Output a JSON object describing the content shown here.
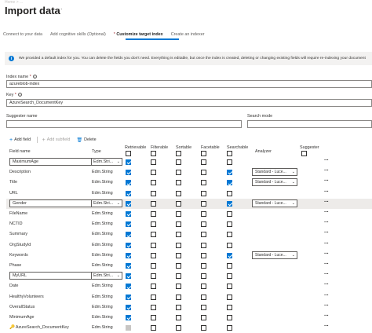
{
  "header": {
    "breadcrumb": "Home > ...",
    "title": "Import data",
    "more_label": "···"
  },
  "tabs": [
    {
      "label": "Connect to your data",
      "active": false
    },
    {
      "label": "Add cognitive skills (Optional)",
      "active": false
    },
    {
      "label": "Customize target index",
      "active": true
    },
    {
      "label": "Create an indexer",
      "active": false
    }
  ],
  "info": {
    "icon": "info-icon",
    "text": "We provided a default index for you. You can delete the fields you don't need. Everything is editable, but once the index is created, deleting or changing existing fields will require re-indexing your document"
  },
  "form": {
    "index_name_label": "Index name",
    "index_name_value": "azureblob-index",
    "key_label": "Key",
    "key_value": "AzureSearch_DocumentKey",
    "suggester_label": "Suggester name",
    "suggester_value": "",
    "search_mode_label": "Search mode",
    "search_mode_value": "",
    "required_mark": "*",
    "info_glyph": "i"
  },
  "toolbar": {
    "add_field": "Add field",
    "add_subfield": "Add subfield",
    "delete": "Delete"
  },
  "columns": {
    "field_name": "Field name",
    "type": "Type",
    "retrievable": "Retrievable",
    "filterable": "Filterable",
    "sortable": "Sortable",
    "facetable": "Facetable",
    "searchable": "Searchable",
    "analyzer": "Analyzer",
    "suggester": "Suggester"
  },
  "rows": [
    {
      "name": "MaximumAge",
      "type": "Edm.Stri...",
      "editable": true,
      "retrievable": true,
      "filterable": false,
      "sortable": false,
      "facetable": false,
      "searchable": false,
      "analyzer": ""
    },
    {
      "name": "Description",
      "type": "Edm.String",
      "editable": false,
      "retrievable": true,
      "filterable": false,
      "sortable": false,
      "facetable": false,
      "searchable": true,
      "analyzer": "Standard - Luce..."
    },
    {
      "name": "Title",
      "type": "Edm.String",
      "editable": false,
      "retrievable": true,
      "filterable": false,
      "sortable": false,
      "facetable": false,
      "searchable": true,
      "analyzer": "Standard - Luce..."
    },
    {
      "name": "URL",
      "type": "Edm.String",
      "editable": false,
      "retrievable": true,
      "filterable": false,
      "sortable": false,
      "facetable": false,
      "searchable": false,
      "analyzer": ""
    },
    {
      "name": "Gender",
      "type": "Edm.Stri...",
      "editable": true,
      "retrievable": true,
      "filterable": false,
      "sortable": false,
      "facetable": false,
      "searchable": true,
      "analyzer": "Standard - Luce..."
    },
    {
      "name": "FileName",
      "type": "Edm.String",
      "editable": false,
      "retrievable": true,
      "filterable": false,
      "sortable": false,
      "facetable": false,
      "searchable": false,
      "analyzer": ""
    },
    {
      "name": "NCTID",
      "type": "Edm.String",
      "editable": false,
      "retrievable": true,
      "filterable": false,
      "sortable": false,
      "facetable": false,
      "searchable": false,
      "analyzer": ""
    },
    {
      "name": "Summary",
      "type": "Edm.String",
      "editable": false,
      "retrievable": true,
      "filterable": false,
      "sortable": false,
      "facetable": false,
      "searchable": false,
      "analyzer": ""
    },
    {
      "name": "OrgStudyId",
      "type": "Edm.String",
      "editable": false,
      "retrievable": true,
      "filterable": false,
      "sortable": false,
      "facetable": false,
      "searchable": false,
      "analyzer": ""
    },
    {
      "name": "Keywords",
      "type": "Edm.String",
      "editable": false,
      "retrievable": true,
      "filterable": false,
      "sortable": false,
      "facetable": false,
      "searchable": true,
      "analyzer": "Standard - Luce..."
    },
    {
      "name": "Phase",
      "type": "Edm.String",
      "editable": false,
      "retrievable": true,
      "filterable": false,
      "sortable": false,
      "facetable": false,
      "searchable": false,
      "analyzer": ""
    },
    {
      "name": "MyURL",
      "type": "Edm.Stri...",
      "editable": true,
      "retrievable": true,
      "filterable": false,
      "sortable": false,
      "facetable": false,
      "searchable": false,
      "analyzer": ""
    },
    {
      "name": "Date",
      "type": "Edm.String",
      "editable": false,
      "retrievable": true,
      "filterable": false,
      "sortable": false,
      "facetable": false,
      "searchable": false,
      "analyzer": ""
    },
    {
      "name": "HealthyVolunteers",
      "type": "Edm.String",
      "editable": false,
      "retrievable": true,
      "filterable": false,
      "sortable": false,
      "facetable": false,
      "searchable": false,
      "analyzer": ""
    },
    {
      "name": "OverallStatus",
      "type": "Edm.String",
      "editable": false,
      "retrievable": true,
      "filterable": false,
      "sortable": false,
      "facetable": false,
      "searchable": false,
      "analyzer": ""
    },
    {
      "name": "MinimumAge",
      "type": "Edm.String",
      "editable": false,
      "retrievable": true,
      "filterable": false,
      "sortable": false,
      "facetable": false,
      "searchable": false,
      "analyzer": ""
    },
    {
      "name": "AzureSearch_DocumentKey",
      "type": "Edm.String",
      "editable": false,
      "key": true,
      "retrievable": "disabled",
      "filterable": false,
      "sortable": false,
      "facetable": false,
      "searchable": false,
      "analyzer": ""
    }
  ],
  "colors": {
    "accent": "#0078d4",
    "highlight_row": "#edebe9"
  }
}
